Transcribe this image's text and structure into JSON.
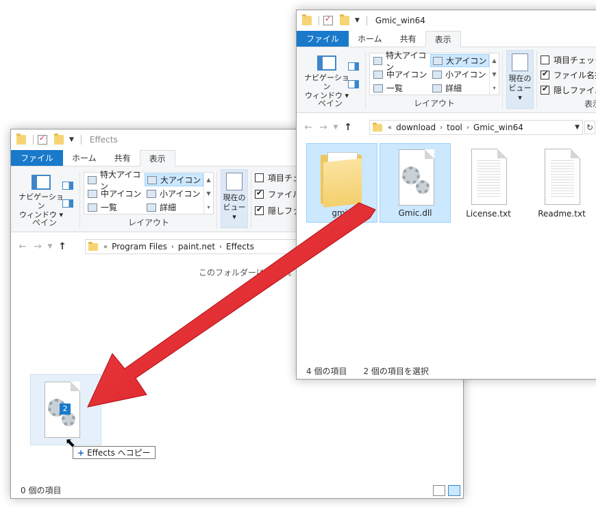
{
  "effects_window": {
    "title": "Effects",
    "tabs": {
      "file": "ファイル",
      "home": "ホーム",
      "share": "共有",
      "view": "表示"
    },
    "ribbon": {
      "nav_pane_line1": "ナビゲーション",
      "nav_pane_line2": "ウィンドウ ▾",
      "pane_group": "ペイン",
      "layout_items": [
        "特大アイコン",
        "大アイコン",
        "中アイコン",
        "小アイコン",
        "一覧",
        "詳細"
      ],
      "layout_group": "レイアウト",
      "current_view_line1": "現在の",
      "current_view_line2": "ビュー ▾",
      "checkbox_item": "項目チェ",
      "checkbox_ext": "ファイル名",
      "checkbox_hidden": "隠しファイ"
    },
    "address": {
      "prefix": "«",
      "crumbs": [
        "Program Files",
        "paint.net",
        "Effects"
      ]
    },
    "empty_message": "このフォルダーは空です。",
    "status": "0 個の項目"
  },
  "gmic_window": {
    "title": "Gmic_win64",
    "tabs": {
      "file": "ファイル",
      "home": "ホーム",
      "share": "共有",
      "view": "表示"
    },
    "ribbon": {
      "nav_pane_line1": "ナビゲーション",
      "nav_pane_line2": "ウィンドウ ▾",
      "pane_group": "ペイン",
      "layout_items": [
        "特大アイコン",
        "大アイコン",
        "中アイコン",
        "小アイコン",
        "一覧",
        "詳細"
      ],
      "layout_group": "レイアウト",
      "current_view_line1": "現在の",
      "current_view_line2": "ビュー ▾",
      "checkbox_item": "項目チェック ボ",
      "checkbox_ext": "ファイル名拡張",
      "checkbox_hidden": "隠しファイル",
      "show_hide_group": "表示/"
    },
    "address": {
      "prefix": "«",
      "crumbs": [
        "download",
        "tool",
        "Gmic_win64"
      ]
    },
    "files": [
      {
        "name": "gmic",
        "kind": "folder"
      },
      {
        "name": "Gmic.dll",
        "kind": "dll"
      },
      {
        "name": "License.txt",
        "kind": "text"
      },
      {
        "name": "Readme.txt",
        "kind": "text"
      }
    ],
    "status_count": "4 個の項目",
    "status_selected": "2 個の項目を選択"
  },
  "drag": {
    "badge_count": "2",
    "tooltip": "Effects へコピー"
  },
  "colors": {
    "accent": "#1979ca",
    "selection": "#cce8ff",
    "arrow": "#e8262b"
  }
}
